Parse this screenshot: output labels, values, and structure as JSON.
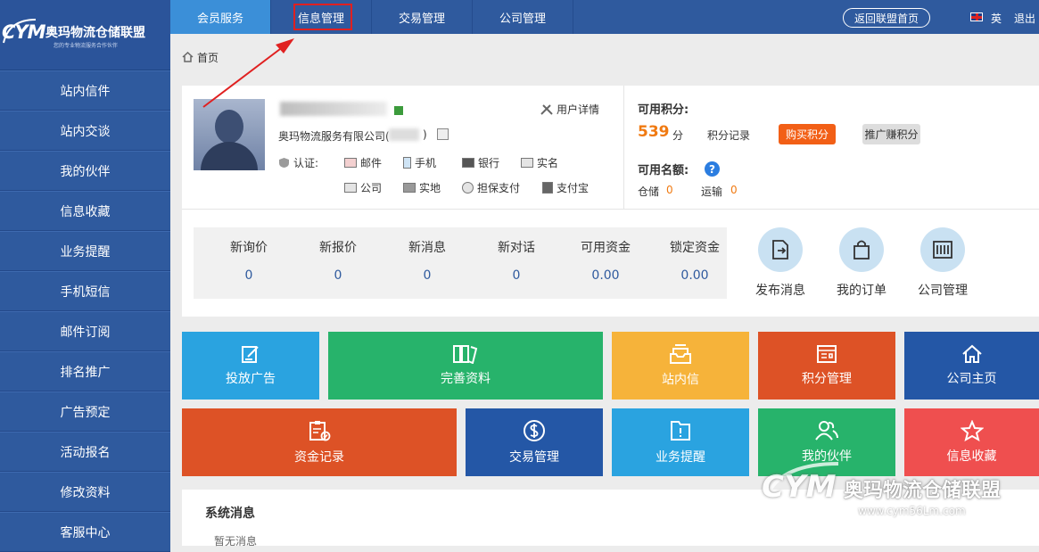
{
  "brand": {
    "logo_mark": "CYM",
    "name": "奥玛物流仓储联盟",
    "slogan": "您的专业物流服务合作伙伴"
  },
  "sidebar": {
    "items": [
      {
        "label": "站内信件"
      },
      {
        "label": "站内交谈"
      },
      {
        "label": "我的伙伴"
      },
      {
        "label": "信息收藏"
      },
      {
        "label": "业务提醒"
      },
      {
        "label": "手机短信"
      },
      {
        "label": "邮件订阅"
      },
      {
        "label": "排名推广"
      },
      {
        "label": "广告预定"
      },
      {
        "label": "活动报名"
      },
      {
        "label": "修改资料"
      },
      {
        "label": "客服中心"
      }
    ]
  },
  "topnav": {
    "tabs": [
      {
        "label": "会员服务",
        "active": true
      },
      {
        "label": "信息管理",
        "active": false
      },
      {
        "label": "交易管理",
        "active": false
      },
      {
        "label": "公司管理",
        "active": false
      }
    ],
    "back_label": "返回联盟首页",
    "lang_label": "英",
    "logout_label": "退出"
  },
  "breadcrumb": {
    "home_label": "首页"
  },
  "profile": {
    "company": "奥玛物流服务有限公司(",
    "company_suffix": ")",
    "user_detail_label": "用户详情",
    "cert_label": "认证:",
    "certs_row1": [
      "邮件",
      "手机",
      "银行",
      "实名"
    ],
    "certs_row2": [
      "公司",
      "实地",
      "担保支付",
      "支付宝"
    ]
  },
  "points": {
    "label": "可用积分:",
    "value": "539",
    "unit": "分",
    "record_label": "积分记录",
    "buy_label": "购买积分",
    "promo_label": "推广赚积分"
  },
  "quota": {
    "label": "可用名额:",
    "help": "?",
    "warehouse_label": "仓储",
    "warehouse_value": "0",
    "transport_label": "运输",
    "transport_value": "0"
  },
  "stats": [
    {
      "label": "新询价",
      "value": "0"
    },
    {
      "label": "新报价",
      "value": "0"
    },
    {
      "label": "新消息",
      "value": "0"
    },
    {
      "label": "新对话",
      "value": "0"
    },
    {
      "label": "可用资金",
      "value": "0.00"
    },
    {
      "label": "锁定资金",
      "value": "0.00"
    }
  ],
  "quick_actions": [
    {
      "label": "发布消息"
    },
    {
      "label": "我的订单"
    },
    {
      "label": "公司管理"
    }
  ],
  "tiles": [
    {
      "label": "投放广告",
      "color": "#2aa3e0"
    },
    {
      "label": "完善资料",
      "color": "#27b36b"
    },
    {
      "label": "站内信",
      "color": "#f6b33a"
    },
    {
      "label": "积分管理",
      "color": "#dd5226"
    },
    {
      "label": "公司主页",
      "color": "#2457a6"
    },
    {
      "label": "资金记录",
      "color": "#dd5226"
    },
    {
      "label": "交易管理",
      "color": "#2457a6"
    },
    {
      "label": "业务提醒",
      "color": "#2aa3e0"
    },
    {
      "label": "我的伙伴",
      "color": "#27b36b"
    },
    {
      "label": "信息收藏",
      "color": "#ef4f4f"
    }
  ],
  "system_messages": {
    "title": "系统消息",
    "empty": "暂无消息"
  },
  "watermark": {
    "mark": "CYM",
    "name": "奥玛物流仓储联盟",
    "url": "www.cym56Lm.com"
  }
}
